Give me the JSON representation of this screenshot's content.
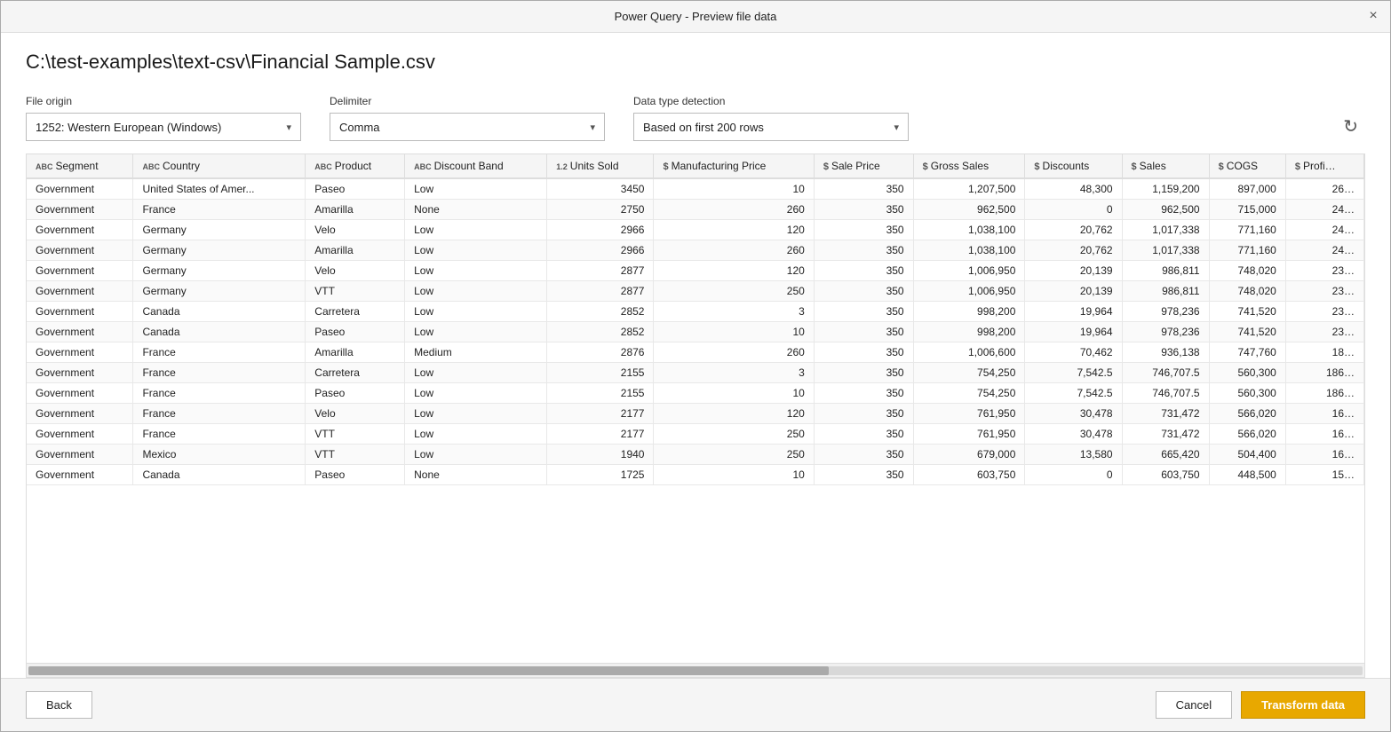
{
  "dialog": {
    "title": "Power Query - Preview file data",
    "close_label": "×"
  },
  "file_path": "C:\\test-examples\\text-csv\\Financial Sample.csv",
  "controls": {
    "file_origin_label": "File origin",
    "file_origin_value": "1252: Western European (Windows)",
    "delimiter_label": "Delimiter",
    "delimiter_value": "Comma",
    "data_type_label": "Data type detection",
    "data_type_value": "Based on first 200 rows"
  },
  "columns": [
    {
      "name": "Segment",
      "type": "abc"
    },
    {
      "name": "Country",
      "type": "abc"
    },
    {
      "name": "Product",
      "type": "abc"
    },
    {
      "name": "Discount Band",
      "type": "abc"
    },
    {
      "name": "Units Sold",
      "type": "12"
    },
    {
      "name": "Manufacturing Price",
      "type": "dollar"
    },
    {
      "name": "Sale Price",
      "type": "dollar"
    },
    {
      "name": "Gross Sales",
      "type": "dollar"
    },
    {
      "name": "Discounts",
      "type": "dollar"
    },
    {
      "name": "Sales",
      "type": "dollar"
    },
    {
      "name": "COGS",
      "type": "dollar"
    },
    {
      "name": "Profi…",
      "type": "dollar"
    }
  ],
  "rows": [
    [
      "Government",
      "United States of Amer...",
      "Paseo",
      "Low",
      "3450",
      "10",
      "350",
      "1,207,500",
      "48,300",
      "1,159,200",
      "897,000",
      "26…"
    ],
    [
      "Government",
      "France",
      "Amarilla",
      "None",
      "2750",
      "260",
      "350",
      "962,500",
      "0",
      "962,500",
      "715,000",
      "24…"
    ],
    [
      "Government",
      "Germany",
      "Velo",
      "Low",
      "2966",
      "120",
      "350",
      "1,038,100",
      "20,762",
      "1,017,338",
      "771,160",
      "24…"
    ],
    [
      "Government",
      "Germany",
      "Amarilla",
      "Low",
      "2966",
      "260",
      "350",
      "1,038,100",
      "20,762",
      "1,017,338",
      "771,160",
      "24…"
    ],
    [
      "Government",
      "Germany",
      "Velo",
      "Low",
      "2877",
      "120",
      "350",
      "1,006,950",
      "20,139",
      "986,811",
      "748,020",
      "23…"
    ],
    [
      "Government",
      "Germany",
      "VTT",
      "Low",
      "2877",
      "250",
      "350",
      "1,006,950",
      "20,139",
      "986,811",
      "748,020",
      "23…"
    ],
    [
      "Government",
      "Canada",
      "Carretera",
      "Low",
      "2852",
      "3",
      "350",
      "998,200",
      "19,964",
      "978,236",
      "741,520",
      "23…"
    ],
    [
      "Government",
      "Canada",
      "Paseo",
      "Low",
      "2852",
      "10",
      "350",
      "998,200",
      "19,964",
      "978,236",
      "741,520",
      "23…"
    ],
    [
      "Government",
      "France",
      "Amarilla",
      "Medium",
      "2876",
      "260",
      "350",
      "1,006,600",
      "70,462",
      "936,138",
      "747,760",
      "18…"
    ],
    [
      "Government",
      "France",
      "Carretera",
      "Low",
      "2155",
      "3",
      "350",
      "754,250",
      "7,542.5",
      "746,707.5",
      "560,300",
      "186…"
    ],
    [
      "Government",
      "France",
      "Paseo",
      "Low",
      "2155",
      "10",
      "350",
      "754,250",
      "7,542.5",
      "746,707.5",
      "560,300",
      "186…"
    ],
    [
      "Government",
      "France",
      "Velo",
      "Low",
      "2177",
      "120",
      "350",
      "761,950",
      "30,478",
      "731,472",
      "566,020",
      "16…"
    ],
    [
      "Government",
      "France",
      "VTT",
      "Low",
      "2177",
      "250",
      "350",
      "761,950",
      "30,478",
      "731,472",
      "566,020",
      "16…"
    ],
    [
      "Government",
      "Mexico",
      "VTT",
      "Low",
      "1940",
      "250",
      "350",
      "679,000",
      "13,580",
      "665,420",
      "504,400",
      "16…"
    ],
    [
      "Government",
      "Canada",
      "Paseo",
      "None",
      "1725",
      "10",
      "350",
      "603,750",
      "0",
      "603,750",
      "448,500",
      "15…"
    ]
  ],
  "footer": {
    "back_label": "Back",
    "cancel_label": "Cancel",
    "transform_label": "Transform data"
  }
}
